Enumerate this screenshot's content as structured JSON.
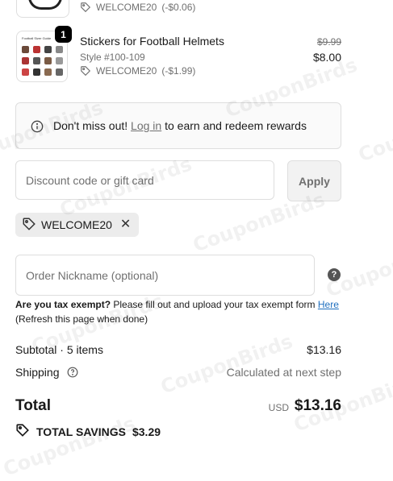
{
  "top_item": {
    "discount_code": "WELCOME20",
    "discount_amount": "(-$0.06)"
  },
  "item": {
    "quantity": "1",
    "title": "Stickers for Football Helmets",
    "style": "Style #100-109",
    "discount_code": "WELCOME20",
    "discount_amount": "(-$1.99)",
    "original_price": "$9.99",
    "price": "$8.00",
    "thumbnail_caption": "Football Sizer Guide"
  },
  "notice": {
    "lead": "Don't miss out!",
    "link": "Log in",
    "rest": "to earn and redeem rewards"
  },
  "discount": {
    "placeholder": "Discount code or gift card",
    "apply_label": "Apply",
    "applied_code": "WELCOME20"
  },
  "nickname": {
    "placeholder": "Order Nickname (optional)",
    "help_symbol": "?"
  },
  "tax": {
    "question": "Are you tax exempt?",
    "text": "Please fill out and upload your tax exempt form",
    "link": "Here",
    "note": "(Refresh this page when done)"
  },
  "summary": {
    "subtotal_label": "Subtotal · 5 items",
    "subtotal_value": "$13.16",
    "shipping_label": "Shipping",
    "shipping_value": "Calculated at next step",
    "total_label": "Total",
    "currency": "USD",
    "total_value": "$13.16",
    "savings_label": "TOTAL SAVINGS",
    "savings_value": "$3.29"
  },
  "watermark": "CouponBirds",
  "colors": {
    "link_blue": "#1f6fbf",
    "muted_text": "#707070",
    "border": "#dedede"
  },
  "icons": [
    "tag-icon",
    "info-icon",
    "close-icon",
    "help-icon",
    "savings-tag-icon"
  ]
}
